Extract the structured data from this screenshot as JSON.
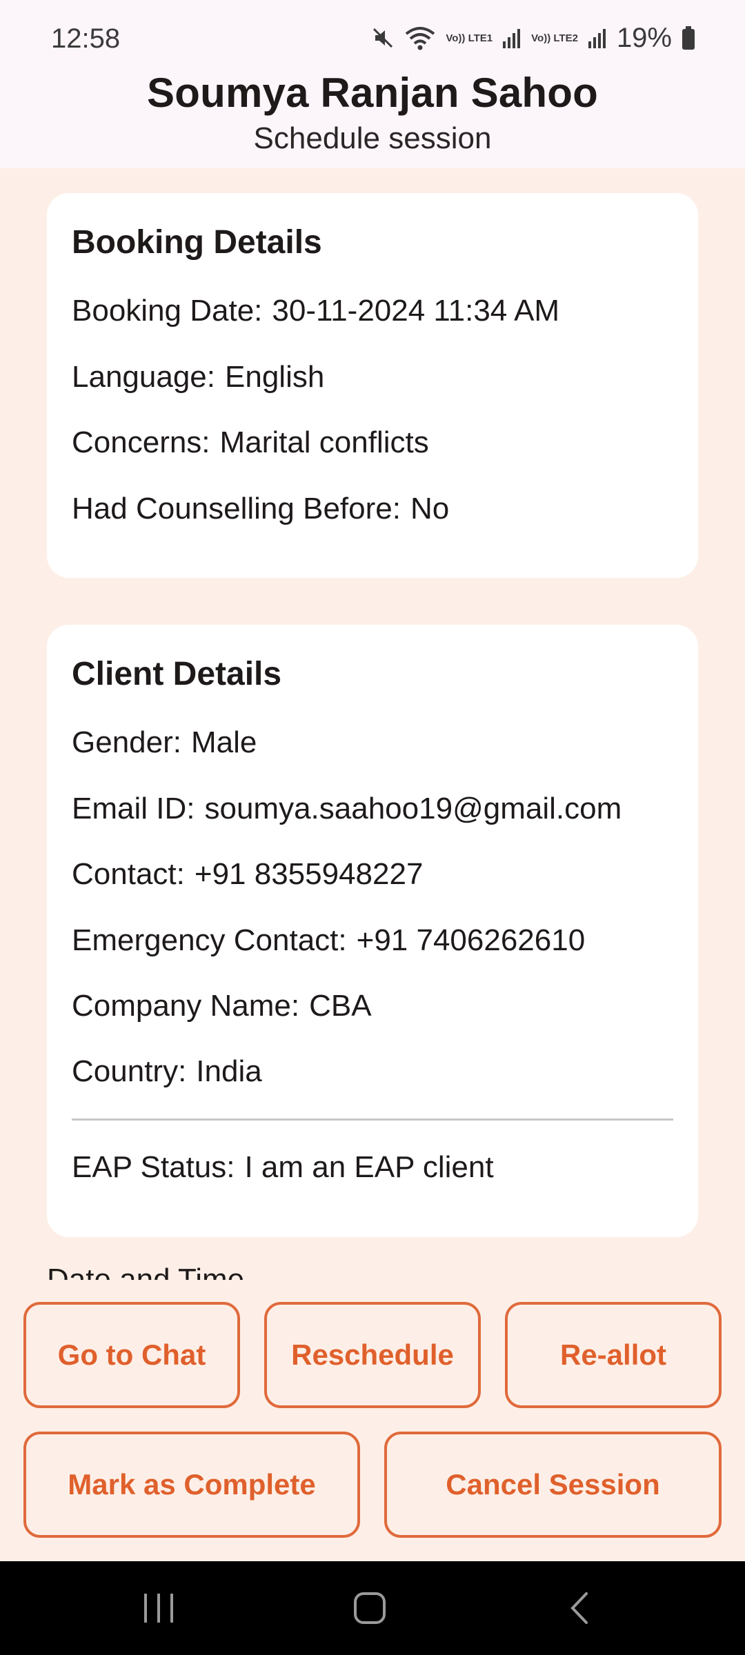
{
  "status_bar": {
    "time": "12:58",
    "network_labels": [
      "Vo)) LTE1",
      "Vo)) LTE2"
    ],
    "battery": "19%",
    "icons": [
      "mute-icon",
      "wifi-icon",
      "signal-icon",
      "battery-icon"
    ]
  },
  "header": {
    "title": "Soumya Ranjan Sahoo",
    "subtitle": "Schedule session"
  },
  "booking": {
    "title": "Booking Details",
    "rows": [
      {
        "label": "Booking Date:",
        "value": "30-11-2024 11:34 AM"
      },
      {
        "label": "Language:",
        "value": "English"
      },
      {
        "label": "Concerns:",
        "value": "Marital conflicts"
      },
      {
        "label": "Had Counselling Before:",
        "value": "No"
      }
    ]
  },
  "client": {
    "title": "Client Details",
    "rows": [
      {
        "label": "Gender:",
        "value": "Male"
      },
      {
        "label": "Email ID:",
        "value": "soumya.saahoo19@gmail.com"
      },
      {
        "label": "Contact:",
        "value": "+91 8355948227"
      },
      {
        "label": "Emergency Contact:",
        "value": "+91 7406262610"
      },
      {
        "label": "Company Name:",
        "value": "CBA"
      },
      {
        "label": "Country:",
        "value": "India"
      }
    ],
    "eap": {
      "label": "EAP Status:",
      "value": "I am an EAP client"
    }
  },
  "next_section_peek": "Date and Time",
  "actions": {
    "go_to_chat": "Go to Chat",
    "reschedule": "Reschedule",
    "re_allot": "Re-allot",
    "mark_complete": "Mark as Complete",
    "cancel_session": "Cancel Session"
  },
  "colors": {
    "accent": "#e0602c",
    "background": "#fdefe7",
    "header_bg": "#fcf5fa",
    "card_bg": "#ffffff"
  }
}
